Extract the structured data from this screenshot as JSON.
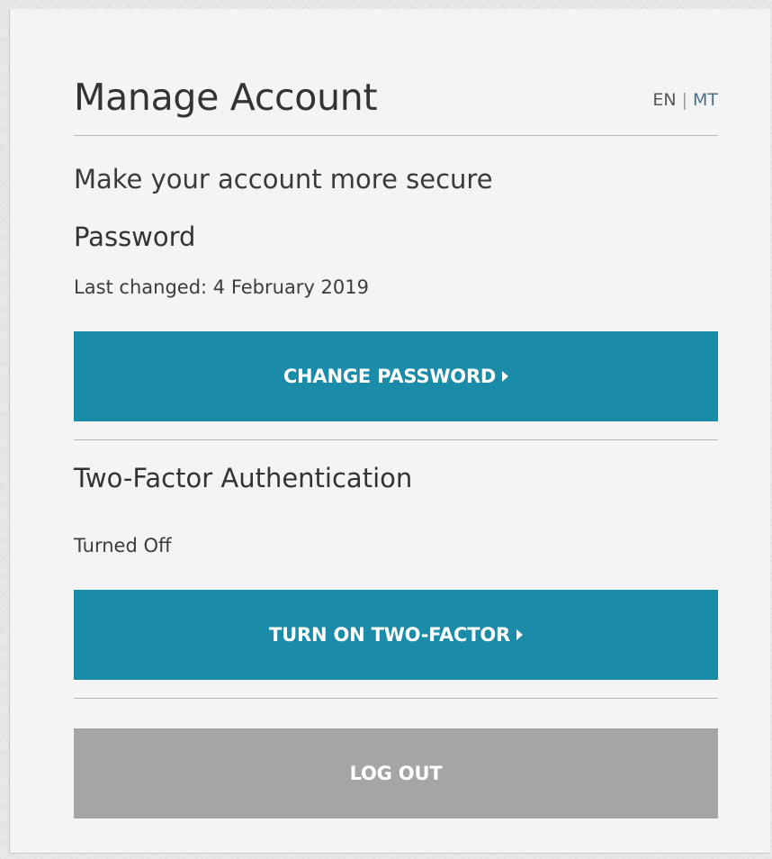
{
  "header": {
    "title": "Manage Account",
    "languages": {
      "en": "EN",
      "separator": "|",
      "mt": "MT"
    }
  },
  "subtitle": "Make your account more secure",
  "password": {
    "heading": "Password",
    "last_changed": "Last changed: 4 February 2019",
    "button_label": "CHANGE PASSWORD",
    "button_icon": "caret-right-icon"
  },
  "two_factor": {
    "heading": "Two-Factor Authentication",
    "status": "Turned Off",
    "button_label": "TURN ON TWO-FACTOR",
    "button_icon": "caret-right-icon"
  },
  "logout": {
    "button_label": "LOG OUT"
  },
  "colors": {
    "primary_button": "#1a8ba8",
    "logout_button": "#a5a5a5",
    "panel_background": "#f4f4f4",
    "text": "#333333"
  }
}
